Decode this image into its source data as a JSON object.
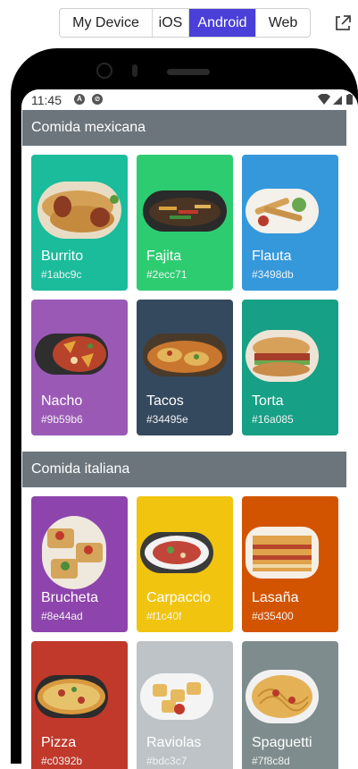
{
  "platform_tabs": [
    {
      "label": "My Device",
      "active": false
    },
    {
      "label": "iOS",
      "active": false
    },
    {
      "label": "Android",
      "active": true
    },
    {
      "label": "Web",
      "active": false
    }
  ],
  "status_bar": {
    "time": "11:45"
  },
  "sections": [
    {
      "title": "Comida mexicana",
      "items": [
        {
          "name": "Burrito",
          "hex": "#1abc9c"
        },
        {
          "name": "Fajita",
          "hex": "#2ecc71"
        },
        {
          "name": "Flauta",
          "hex": "#3498db"
        },
        {
          "name": "Nacho",
          "hex": "#9b59b6"
        },
        {
          "name": "Tacos",
          "hex": "#34495e"
        },
        {
          "name": "Torta",
          "hex": "#16a085"
        }
      ]
    },
    {
      "title": "Comida italiana",
      "items": [
        {
          "name": "Brucheta",
          "hex": "#8e44ad"
        },
        {
          "name": "Carpaccio",
          "hex": "#f1c40f"
        },
        {
          "name": "Lasaña",
          "hex": "#d35400"
        },
        {
          "name": "Pizza",
          "hex": "#c0392b"
        },
        {
          "name": "Raviolas",
          "hex": "#bdc3c7"
        },
        {
          "name": "Spaguetti",
          "hex": "#7f8c8d"
        }
      ]
    }
  ]
}
